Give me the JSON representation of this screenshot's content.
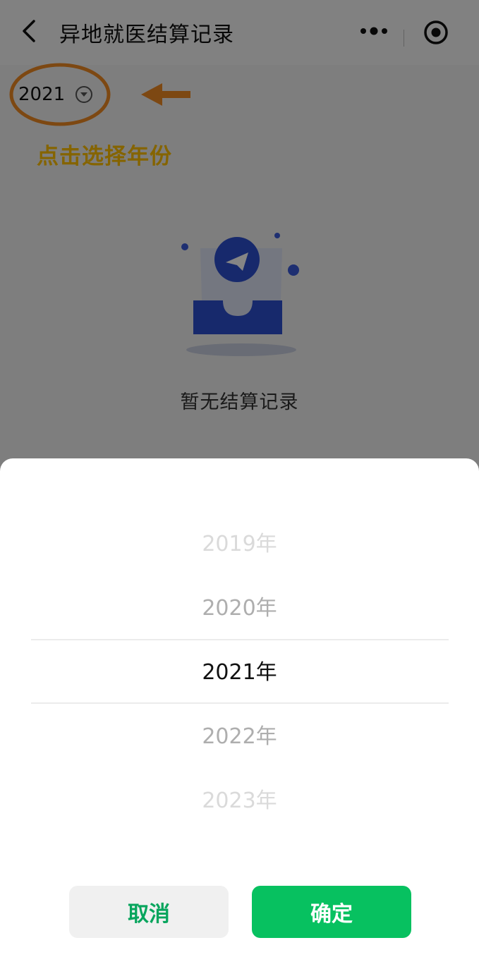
{
  "navbar": {
    "title": "异地就医结算记录"
  },
  "year_selector": {
    "value": "2021"
  },
  "annotation": {
    "text": "点击选择年份",
    "color": "#ffc000"
  },
  "empty_state": {
    "text": "暂无结算记录"
  },
  "picker": {
    "items": [
      "2019年",
      "2020年",
      "2021年",
      "2022年",
      "2023年"
    ],
    "selected": "2021年"
  },
  "buttons": {
    "cancel": "取消",
    "confirm": "确定"
  },
  "colors": {
    "primary": "#07c160",
    "annotation": "#f08a24"
  }
}
